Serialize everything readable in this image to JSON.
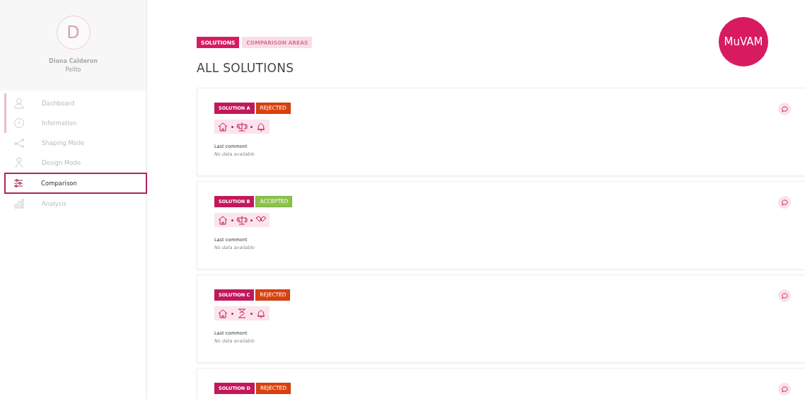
{
  "profile": {
    "initial": "D",
    "name": "Diana Calderon",
    "place": "Polito"
  },
  "nav": [
    {
      "label": "Dashboard",
      "kind": "user",
      "done": true,
      "selected": false
    },
    {
      "label": "Information",
      "kind": "info",
      "done": true,
      "selected": false
    },
    {
      "label": "Shaping Mode",
      "kind": "network",
      "done": false,
      "selected": false
    },
    {
      "label": "Design Mode",
      "kind": "person",
      "done": false,
      "selected": false
    },
    {
      "label": "Comparison",
      "kind": "sliders",
      "done": false,
      "selected": true
    },
    {
      "label": "Analysis",
      "kind": "chart",
      "done": false,
      "selected": false
    }
  ],
  "tabs": [
    {
      "label": "SOLUTIONS",
      "selected": true
    },
    {
      "label": "COMPARISON AREAS",
      "selected": false
    }
  ],
  "title": "ALL SOLUTIONS",
  "logo": "MuVAM",
  "solutions": [
    {
      "name": "SOLUTION A",
      "status": "REJECTED",
      "color": "#d9420f",
      "icons": [
        {
          "kind": "home"
        },
        {
          "kind": "scales"
        },
        {
          "kind": "bell"
        }
      ],
      "comment_label": "Last comment",
      "comment": "No data available"
    },
    {
      "name": "SOLUTION B",
      "status": "ACCEPTED",
      "color": "#8bc34a",
      "icons": [
        {
          "kind": "home"
        },
        {
          "kind": "scales"
        },
        {
          "kind": "hands"
        }
      ],
      "comment_label": "Last comment",
      "comment": "No data available"
    },
    {
      "name": "SOLUTION C",
      "status": "REJECTED",
      "color": "#d9420f",
      "icons": [
        {
          "kind": "home"
        },
        {
          "kind": "hourglass"
        },
        {
          "kind": "bell"
        }
      ],
      "comment_label": "Last comment",
      "comment": "No data available"
    },
    {
      "name": "SOLUTION D",
      "status": "REJECTED",
      "color": "#d9420f"
    }
  ]
}
